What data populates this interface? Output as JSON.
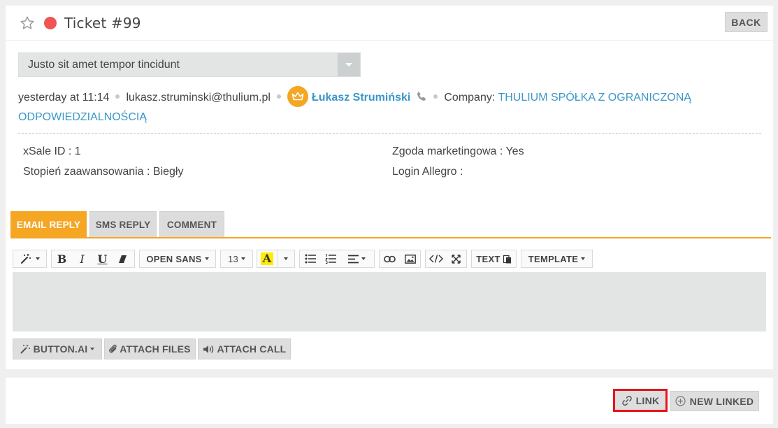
{
  "header": {
    "title": "Ticket #99",
    "back_label": "BACK",
    "status_color": "#f05454",
    "star_icon": "star-outline-icon"
  },
  "subject": {
    "value": "Justo sit amet tempor tincidunt"
  },
  "meta": {
    "time": "yesterday at 11:14",
    "email": "lukasz.struminski@thulium.pl",
    "user_name": "Łukasz Strumiński",
    "company_label": "Company:",
    "company_name_line1": "THULIUM SPÓŁKA Z OGRANICZONĄ",
    "company_name_line2": "ODPOWIEDZIALNOŚCIĄ"
  },
  "fields": {
    "xsale": "xSale ID : 1",
    "zgoda": "Zgoda marketingowa : Yes",
    "stopien": "Stopień zaawansowania : Biegły",
    "login": "Login Allegro :"
  },
  "tabs": [
    {
      "label": "EMAIL REPLY",
      "active": true
    },
    {
      "label": "SMS REPLY",
      "active": false
    },
    {
      "label": "COMMENT",
      "active": false
    }
  ],
  "toolbar": {
    "font": "OPEN SANS",
    "size": "13",
    "text_label": "TEXT",
    "template_label": "TEMPLATE"
  },
  "attach": {
    "buttonai": "BUTTON.AI",
    "files": "ATTACH FILES",
    "call": "ATTACH CALL"
  },
  "bottom": {
    "link": "LINK",
    "new_linked": "NEW LINKED"
  },
  "colors": {
    "accent": "#f5a623",
    "link": "#3b97c9",
    "highlight_border": "#e8141c"
  }
}
